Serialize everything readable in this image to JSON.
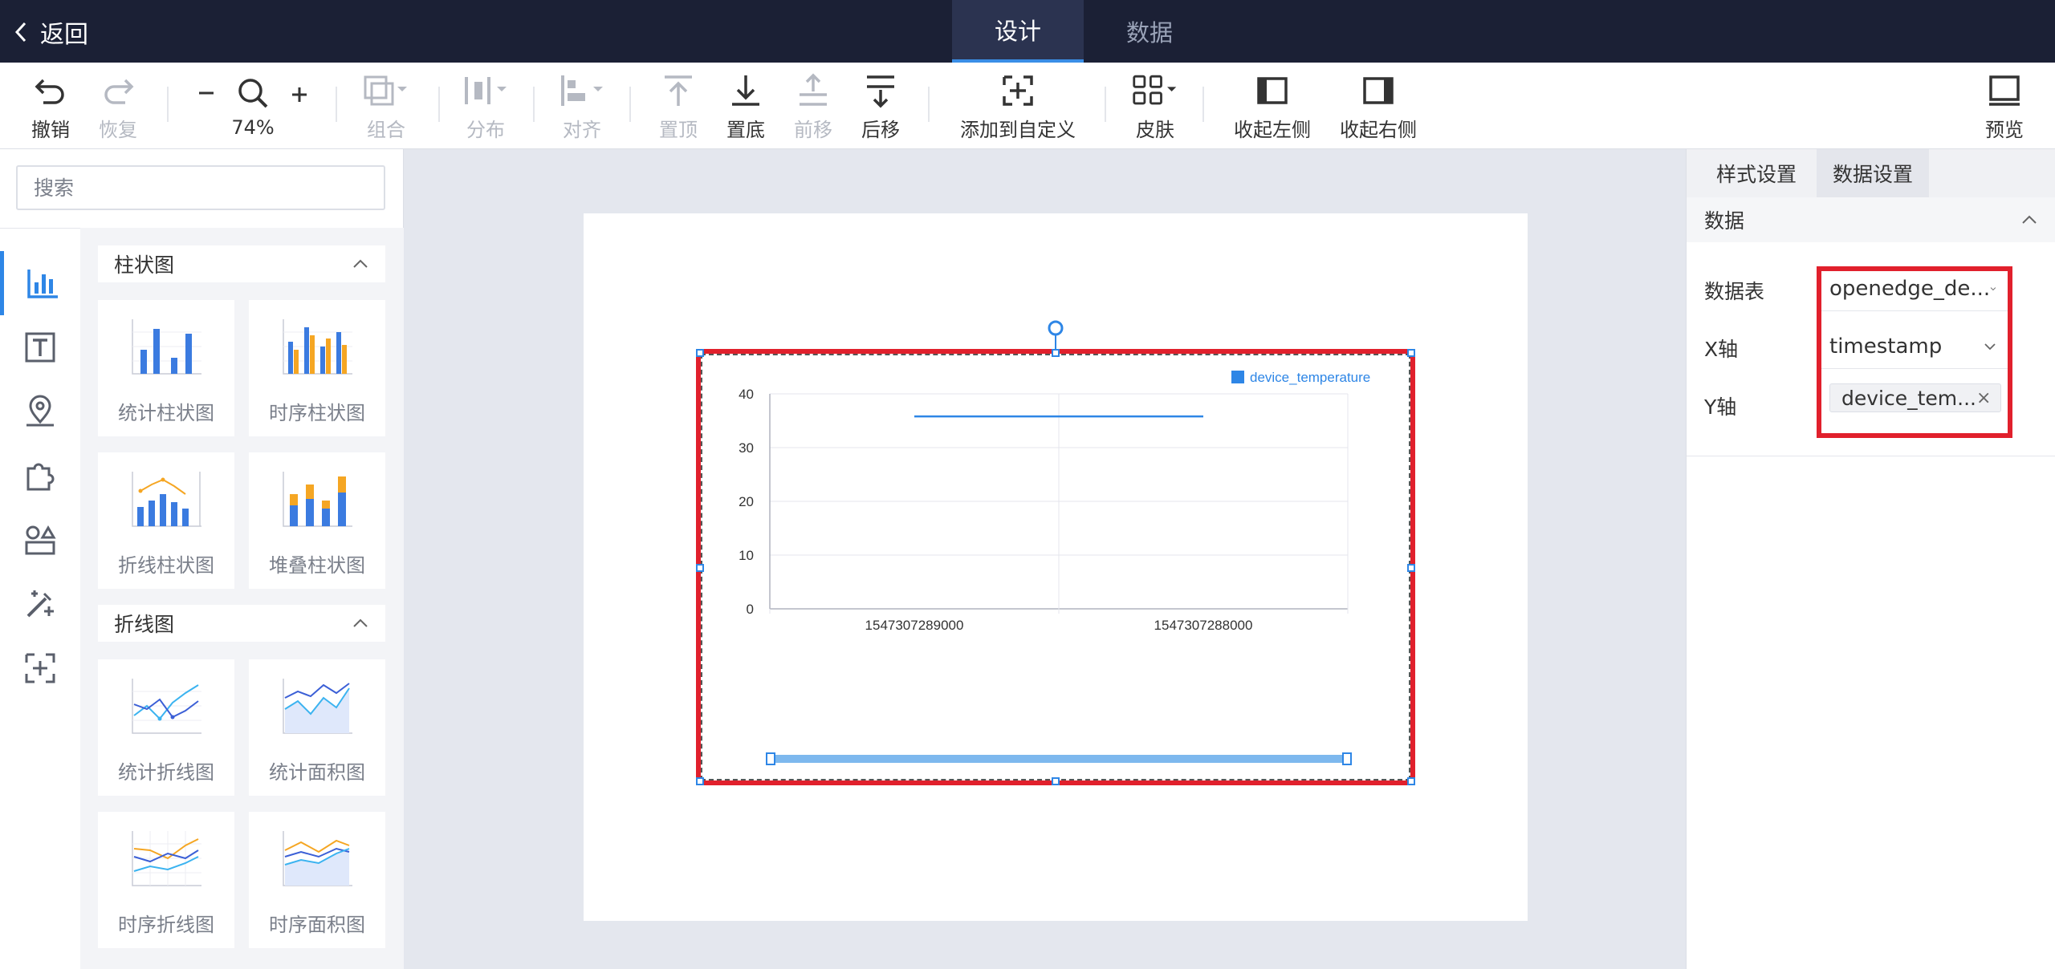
{
  "topbar": {
    "back_label": "返回",
    "tabs": [
      {
        "label": "设计"
      },
      {
        "label": "数据"
      }
    ]
  },
  "toolbar": {
    "undo": "撤销",
    "redo": "恢复",
    "zoom": "74%",
    "group": "组合",
    "distribute": "分布",
    "align": "对齐",
    "to_top": "置顶",
    "to_bottom": "置底",
    "forward": "前移",
    "backward": "后移",
    "add_custom": "添加到自定义",
    "skin": "皮肤",
    "collapse_left": "收起左侧",
    "collapse_right": "收起右侧",
    "preview": "预览"
  },
  "left": {
    "search_placeholder": "搜索",
    "sections": [
      {
        "title": "柱状图",
        "items": [
          "统计柱状图",
          "时序柱状图",
          "折线柱状图",
          "堆叠柱状图"
        ]
      },
      {
        "title": "折线图",
        "items": [
          "统计折线图",
          "统计面积图",
          "时序折线图",
          "时序面积图"
        ]
      }
    ]
  },
  "right": {
    "tabs": [
      "样式设置",
      "数据设置"
    ],
    "section_title": "数据",
    "fields": {
      "table_label": "数据表",
      "table_value": "openedge_de...",
      "x_label": "X轴",
      "x_value": "timestamp",
      "y_label": "Y轴",
      "y_tag": "device_tem..."
    }
  },
  "colors": {
    "accent": "#2e86e6",
    "highlight": "#e1202c",
    "topbar": "#1b2035",
    "bar_orange": "#f5a623"
  },
  "chart_data": {
    "type": "line",
    "title": "",
    "xlabel": "",
    "ylabel": "",
    "categories": [
      "1547307289000",
      "1547307288000"
    ],
    "series": [
      {
        "name": "device_temperature",
        "values": [
          35.8,
          35.8
        ]
      }
    ],
    "ylim": [
      0,
      40
    ],
    "yticks": [
      "0",
      "10",
      "20",
      "30",
      "40"
    ],
    "grid": true,
    "legend": "top-right",
    "datazoom": true
  }
}
